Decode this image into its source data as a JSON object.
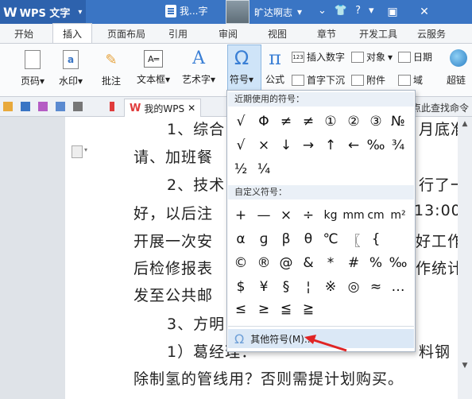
{
  "app": {
    "logo_text": "W",
    "title": "WPS 文字",
    "caret": "▾"
  },
  "doc_tab": {
    "label": "我...字"
  },
  "user": {
    "name": "旷达啊志",
    "caret": "▾"
  },
  "title_icons": [
    "shirt-icon",
    "help-icon",
    "minimize-icon"
  ],
  "title_glyphs": {
    "v": "⌄",
    "shirt": "👕",
    "help": "?",
    "down": "▾"
  },
  "window_controls": {
    "restore": "▣",
    "close": "✕"
  },
  "menu_tabs": [
    "开始",
    "插入",
    "页面布局",
    "引用",
    "审阅",
    "视图",
    "章节",
    "开发工具",
    "云服务"
  ],
  "active_menu_tab": "插入",
  "ribbon": {
    "page_number": "页码",
    "watermark": "水印",
    "comment": "批注",
    "textbox": "文本框",
    "wordart": "艺术字",
    "symbol": "符号",
    "formula": "公式",
    "insert_number": "插入数字",
    "object": "对象",
    "date": "日期",
    "first_char_drop": "首字下沉",
    "attachment": "附件",
    "field": "域",
    "hyperlink": "超链",
    "dropdown": "▾",
    "icon_a": "a",
    "icon_textbox": "A═",
    "icon_art": "A",
    "icon_omega": "Ω",
    "icon_pi": "π",
    "icon_123": "123",
    "icon_comment": "✎"
  },
  "qat": {
    "doc_tab_label": "我的WPS",
    "close": "✕",
    "find_command": "点此查找命令"
  },
  "symbol_popup": {
    "recent_header": "近期使用的符号：",
    "recent_symbols": [
      "√",
      "Φ",
      "≠",
      "≠",
      "①",
      "②",
      "③",
      "№",
      "√",
      "×",
      "↓",
      "→",
      "↑",
      "←",
      "‰",
      "¾",
      "½",
      "¼"
    ],
    "custom_header": "自定义符号：",
    "custom_symbols": [
      "+",
      "—",
      "×",
      "÷",
      "kg",
      "mm",
      "cm",
      "m²",
      "α",
      "ɡ",
      "β",
      "θ",
      "℃",
      "〖",
      "{",
      "©",
      "®",
      "@",
      "&",
      "*",
      "#",
      "%",
      "‰",
      "$",
      "¥",
      "§",
      "¦",
      "※",
      "◎",
      "≈",
      "…",
      "≤",
      "≥",
      "≦",
      "≧"
    ],
    "more_label": "其他符号(M)...",
    "more_icon": "Ω"
  },
  "document": {
    "lines": [
      "1、综合",
      "月底准",
      "请、加班餐",
      "2、技术",
      "行了一",
      "好，以后注",
      "13:00",
      "开展一次安",
      "好工作",
      "后检修报表",
      "作统计",
      "发至公共邮",
      "3、方明",
      "1）葛经理：",
      "料钢",
      "除制氢的管线用？否则需提计划购买。"
    ]
  },
  "scroll": {
    "up": "▲",
    "down": "▼"
  },
  "colors": {
    "title_bar": "#3a75c4",
    "accent": "#3a7fd5",
    "annotation_arrow": "#e02424"
  }
}
